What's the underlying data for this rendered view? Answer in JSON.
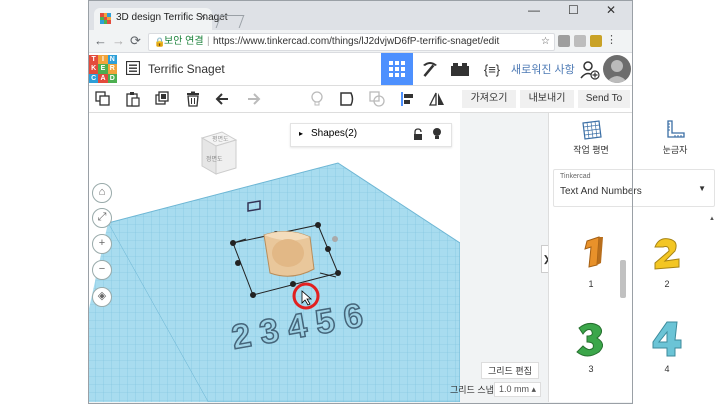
{
  "browser": {
    "tab_title": "3D design Terrific Snaget",
    "tab_close": "×",
    "window_controls": {
      "minimize": "—",
      "maximize": "☐",
      "close": "✕"
    },
    "nav": {
      "back": "←",
      "forward": "→",
      "reload": "⟳"
    },
    "secure_label": "보안 연결",
    "url": "https://www.tinkercad.com/things/lJ2dvjwD6fP-terrific-snaget/edit",
    "bookmark_icon": "☆"
  },
  "app": {
    "logo_letters": [
      "T",
      "I",
      "N",
      "K",
      "E",
      "R",
      "C",
      "A",
      "D"
    ],
    "logo_colors": [
      "#e34b3c",
      "#f2a33a",
      "#2d9fd8",
      "#e34b3c",
      "#4caf50",
      "#f2a33a",
      "#2d9fd8",
      "#e34b3c",
      "#4caf50"
    ],
    "design_title": "Terrific Snaget",
    "code_label": "{≡}",
    "news_link": "새로워진 사항",
    "accent_color": "#4d90fe"
  },
  "toolbar": {
    "import_label": "가져오기",
    "export_label": "내보내기",
    "send_to_label": "Send To"
  },
  "workplane": {
    "shapes_label": "Shapes(2)",
    "viewcube_top": "평면도",
    "viewcube_front": "정면도",
    "grid_edit_label": "그리드 편집",
    "snap_label": "그리드 스냅",
    "snap_value": "1.0 mm",
    "number_text": "2 3 4 5 6"
  },
  "right_panel": {
    "workplane_label": "작업 평면",
    "ruler_label": "눈금자",
    "library_caption": "Tinkercad",
    "library_value": "Text And Numbers",
    "collapse_icon": "❯",
    "shapes": [
      {
        "label": "1",
        "color": "#e8912a"
      },
      {
        "label": "2",
        "color": "#f3c623"
      },
      {
        "label": "3",
        "color": "#3ba64a"
      },
      {
        "label": "4",
        "color": "#6bc4d6"
      }
    ]
  }
}
